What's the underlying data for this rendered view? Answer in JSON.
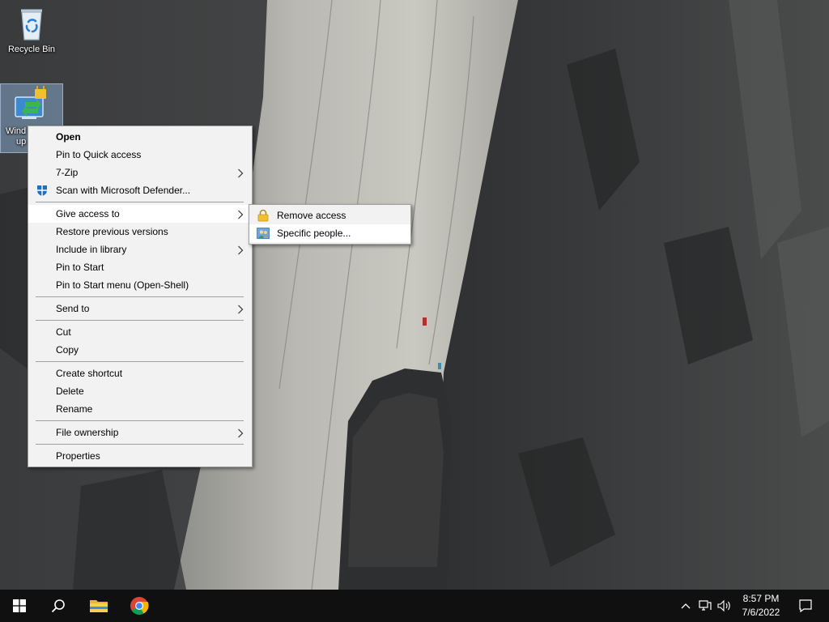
{
  "desktop": {
    "icons": [
      {
        "label": "Recycle Bin",
        "icon": "recycle-bin-icon"
      },
      {
        "label": "Windows update",
        "visible_label": [
          "Wind",
          "up"
        ],
        "icon": "windows-update-lock-icon"
      }
    ]
  },
  "context_menu": {
    "items": [
      {
        "label": "Open",
        "bold": true
      },
      {
        "label": "Pin to Quick access"
      },
      {
        "label": "7-Zip",
        "submenu": true
      },
      {
        "label": "Scan with Microsoft Defender...",
        "icon": "defender-shield-icon"
      },
      {
        "separator": true
      },
      {
        "label": "Give access to",
        "submenu": true,
        "hover": true
      },
      {
        "label": "Restore previous versions"
      },
      {
        "label": "Include in library",
        "submenu": true
      },
      {
        "label": "Pin to Start"
      },
      {
        "label": "Pin to Start menu (Open-Shell)"
      },
      {
        "separator": true
      },
      {
        "label": "Send to",
        "submenu": true
      },
      {
        "separator": true
      },
      {
        "label": "Cut"
      },
      {
        "label": "Copy"
      },
      {
        "separator": true
      },
      {
        "label": "Create shortcut"
      },
      {
        "label": "Delete"
      },
      {
        "label": "Rename"
      },
      {
        "separator": true
      },
      {
        "label": "File ownership",
        "submenu": true
      },
      {
        "separator": true
      },
      {
        "label": "Properties"
      }
    ]
  },
  "submenu": {
    "items": [
      {
        "label": "Remove access",
        "icon": "lock-icon"
      },
      {
        "label": "Specific people...",
        "icon": "people-icon",
        "hover": true
      }
    ]
  },
  "taskbar": {
    "buttons": [
      "start-button",
      "search-button",
      "file-explorer-button",
      "chrome-button"
    ],
    "clock": {
      "time": "8:57 PM",
      "date": "7/6/2022"
    }
  },
  "colors": {
    "menu_bg": "#f2f2f2",
    "menu_hover": "#ffffff",
    "taskbar": "#101010",
    "selection": "#96bee6"
  }
}
